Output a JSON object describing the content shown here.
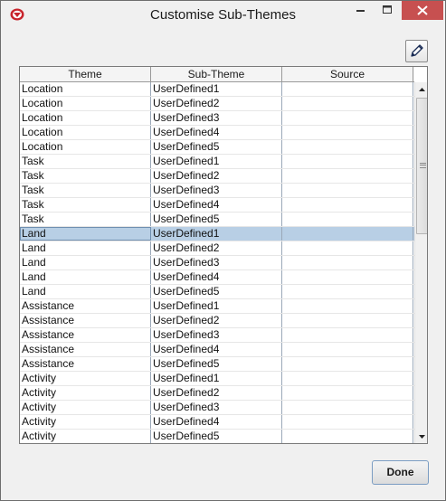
{
  "window": {
    "title": "Customise Sub-Themes",
    "close_color": "#c75050"
  },
  "toolbar": {
    "edit_icon": "pencil-icon"
  },
  "table": {
    "columns": [
      "Theme",
      "Sub-Theme",
      "Source"
    ],
    "selected_row_index": 10,
    "selection_color": "#b8cfe5",
    "rows": [
      {
        "theme": "Location",
        "sub_theme": "UserDefined1",
        "source": ""
      },
      {
        "theme": "Location",
        "sub_theme": "UserDefined2",
        "source": ""
      },
      {
        "theme": "Location",
        "sub_theme": "UserDefined3",
        "source": ""
      },
      {
        "theme": "Location",
        "sub_theme": "UserDefined4",
        "source": ""
      },
      {
        "theme": "Location",
        "sub_theme": "UserDefined5",
        "source": ""
      },
      {
        "theme": "Task",
        "sub_theme": "UserDefined1",
        "source": ""
      },
      {
        "theme": "Task",
        "sub_theme": "UserDefined2",
        "source": ""
      },
      {
        "theme": "Task",
        "sub_theme": "UserDefined3",
        "source": ""
      },
      {
        "theme": "Task",
        "sub_theme": "UserDefined4",
        "source": ""
      },
      {
        "theme": "Task",
        "sub_theme": "UserDefined5",
        "source": ""
      },
      {
        "theme": "Land",
        "sub_theme": "UserDefined1",
        "source": ""
      },
      {
        "theme": "Land",
        "sub_theme": "UserDefined2",
        "source": ""
      },
      {
        "theme": "Land",
        "sub_theme": "UserDefined3",
        "source": ""
      },
      {
        "theme": "Land",
        "sub_theme": "UserDefined4",
        "source": ""
      },
      {
        "theme": "Land",
        "sub_theme": "UserDefined5",
        "source": ""
      },
      {
        "theme": "Assistance",
        "sub_theme": "UserDefined1",
        "source": ""
      },
      {
        "theme": "Assistance",
        "sub_theme": "UserDefined2",
        "source": ""
      },
      {
        "theme": "Assistance",
        "sub_theme": "UserDefined3",
        "source": ""
      },
      {
        "theme": "Assistance",
        "sub_theme": "UserDefined4",
        "source": ""
      },
      {
        "theme": "Assistance",
        "sub_theme": "UserDefined5",
        "source": ""
      },
      {
        "theme": "Activity",
        "sub_theme": "UserDefined1",
        "source": ""
      },
      {
        "theme": "Activity",
        "sub_theme": "UserDefined2",
        "source": ""
      },
      {
        "theme": "Activity",
        "sub_theme": "UserDefined3",
        "source": ""
      },
      {
        "theme": "Activity",
        "sub_theme": "UserDefined4",
        "source": ""
      },
      {
        "theme": "Activity",
        "sub_theme": "UserDefined5",
        "source": ""
      }
    ]
  },
  "footer": {
    "done_label": "Done"
  }
}
